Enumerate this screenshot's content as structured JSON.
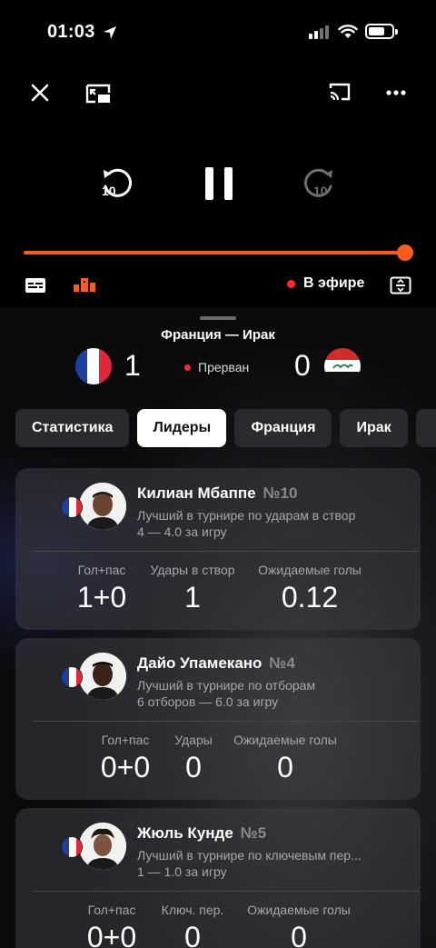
{
  "status_bar": {
    "time": "01:03"
  },
  "player": {
    "live_label": "В эфире",
    "progress_percent": 100
  },
  "match": {
    "title": "Франция — Ирак",
    "home_score": "1",
    "away_score": "0",
    "status": "Прерван"
  },
  "tabs": [
    {
      "label": "Статистика"
    },
    {
      "label": "Лидеры"
    },
    {
      "label": "Франция"
    },
    {
      "label": "Ирак"
    }
  ],
  "active_tab": "Лидеры",
  "leaders": [
    {
      "name": "Килиан Мбаппе",
      "number": "№10",
      "desc1": "Лучший в турнире по ударам в створ",
      "desc2": "4 — 4.0 за игру",
      "stats": [
        {
          "label": "Гол+пас",
          "value": "1+0"
        },
        {
          "label": "Удары в створ",
          "value": "1"
        },
        {
          "label": "Ожидаемые голы",
          "value": "0.12"
        }
      ]
    },
    {
      "name": "Дайо Упамекано",
      "number": "№4",
      "desc1": "Лучший в турнире по отборам",
      "desc2": "6 отборов — 6.0 за игру",
      "stats": [
        {
          "label": "Гол+пас",
          "value": "0+0"
        },
        {
          "label": "Удары",
          "value": "0"
        },
        {
          "label": "Ожидаемые голы",
          "value": "0"
        }
      ]
    },
    {
      "name": "Жюль Кунде",
      "number": "№5",
      "desc1": "Лучший в турнире по ключевым пер...",
      "desc2": "1 — 1.0 за игру",
      "stats": [
        {
          "label": "Гол+пас",
          "value": "0+0"
        },
        {
          "label": "Ключ. пер.",
          "value": "0"
        },
        {
          "label": "Ожидаемые голы",
          "value": "0"
        }
      ]
    }
  ],
  "colors": {
    "accent": "#ff5a1f",
    "live": "#ff2a2a",
    "background": "#000000"
  },
  "icons": [
    "close-icon",
    "picture-in-picture-icon",
    "cast-icon",
    "more-icon",
    "rewind-10-icon",
    "pause-icon",
    "forward-10-icon",
    "subtitles-icon",
    "stats-icon",
    "screen-mode-icon",
    "location-arrow-icon",
    "signal-icon",
    "wifi-icon",
    "battery-icon"
  ]
}
